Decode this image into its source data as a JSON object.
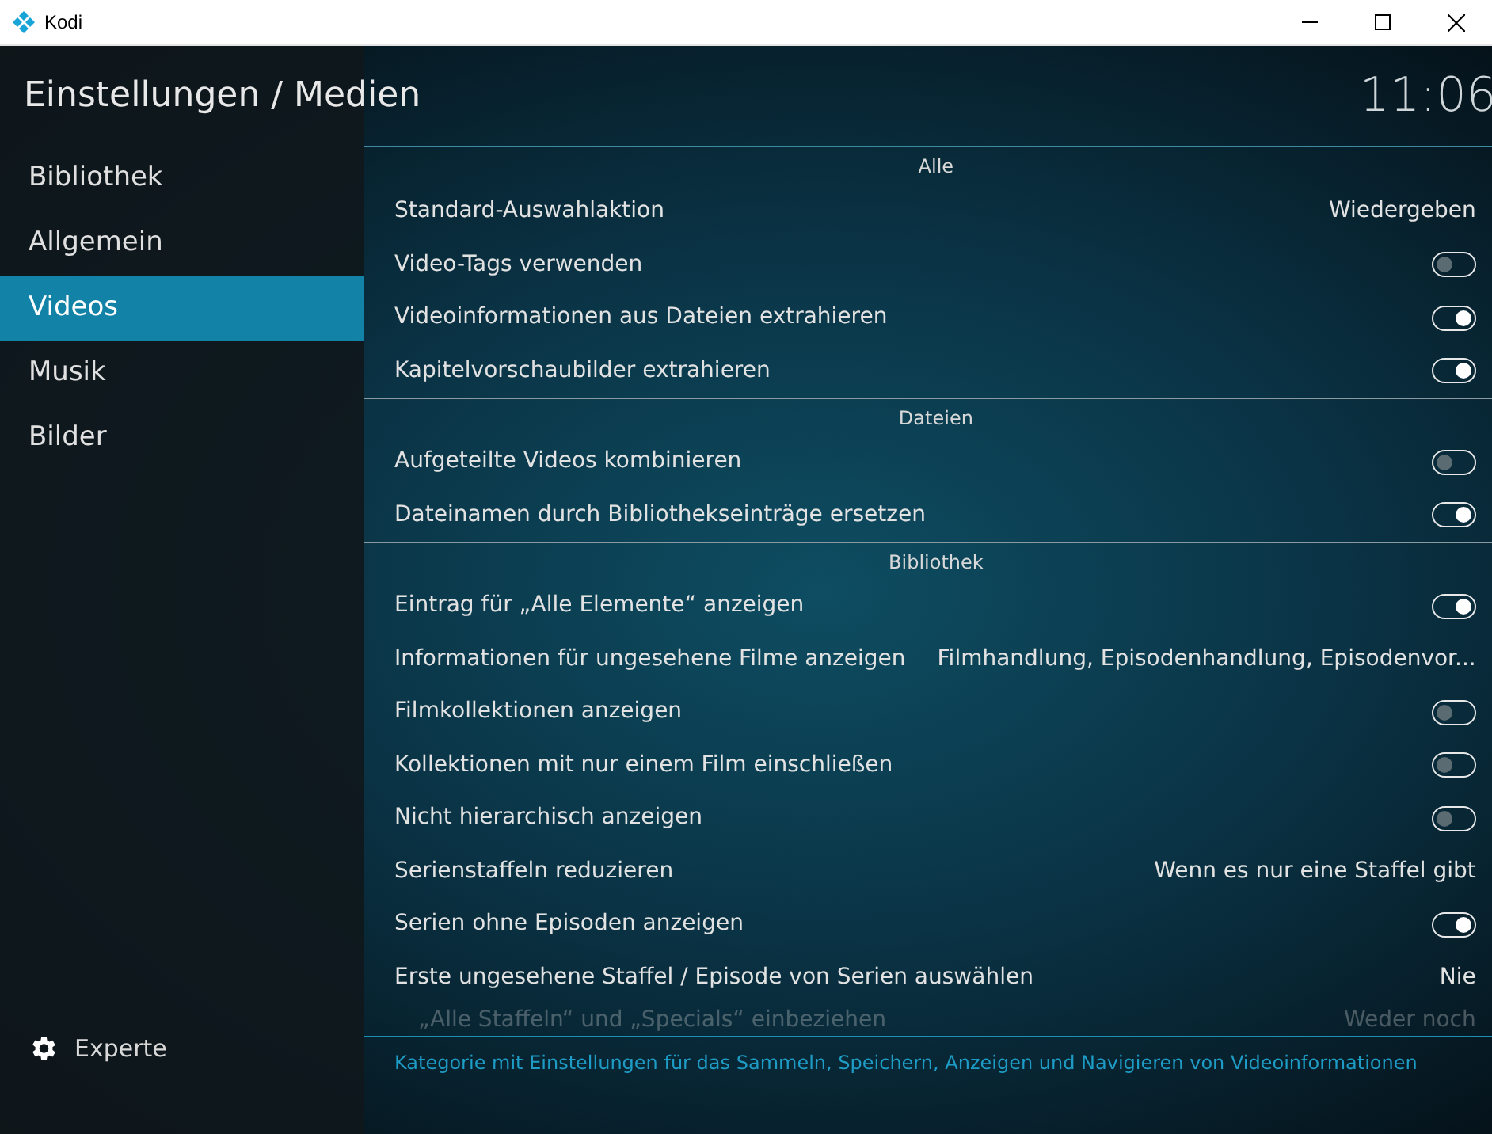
{
  "window": {
    "title": "Kodi"
  },
  "header": {
    "title": "Einstellungen / Medien",
    "clock": "11:06"
  },
  "sidebar": {
    "items": [
      {
        "label": "Bibliothek",
        "selected": false
      },
      {
        "label": "Allgemein",
        "selected": false
      },
      {
        "label": "Videos",
        "selected": true
      },
      {
        "label": "Musik",
        "selected": false
      },
      {
        "label": "Bilder",
        "selected": false
      }
    ],
    "level_button": "Experte"
  },
  "sections": [
    {
      "title": "Alle",
      "rows": [
        {
          "kind": "value",
          "label": "Standard-Auswahlaktion",
          "value": "Wiedergeben",
          "disabled": false
        },
        {
          "kind": "toggle",
          "label": "Video-Tags verwenden",
          "on": false,
          "disabled": false
        },
        {
          "kind": "toggle",
          "label": "Videoinformationen aus Dateien extrahieren",
          "on": true,
          "disabled": false
        },
        {
          "kind": "toggle",
          "label": "Kapitelvorschaubilder extrahieren",
          "on": true,
          "disabled": false
        }
      ]
    },
    {
      "title": "Dateien",
      "rows": [
        {
          "kind": "toggle",
          "label": "Aufgeteilte Videos kombinieren",
          "on": false,
          "disabled": false
        },
        {
          "kind": "toggle",
          "label": "Dateinamen durch Bibliothekseinträge ersetzen",
          "on": true,
          "disabled": false
        }
      ]
    },
    {
      "title": "Bibliothek",
      "rows": [
        {
          "kind": "toggle",
          "label": "Eintrag für „Alle Elemente“ anzeigen",
          "on": true,
          "disabled": false
        },
        {
          "kind": "value",
          "label": "Informationen für ungesehene Filme anzeigen",
          "value": "Filmhandlung, Episodenhandlung, Episodenvor...",
          "disabled": false
        },
        {
          "kind": "toggle",
          "label": "Filmkollektionen anzeigen",
          "on": false,
          "disabled": false
        },
        {
          "kind": "toggle",
          "label": "Kollektionen mit nur einem Film einschließen",
          "on": false,
          "disabled": false
        },
        {
          "kind": "toggle",
          "label": "Nicht hierarchisch anzeigen",
          "on": false,
          "disabled": false
        },
        {
          "kind": "value",
          "label": "Serienstaffeln reduzieren",
          "value": "Wenn es nur eine Staffel gibt",
          "disabled": false
        },
        {
          "kind": "toggle",
          "label": "Serien ohne Episoden anzeigen",
          "on": true,
          "disabled": false
        },
        {
          "kind": "value",
          "label": "Erste ungesehene Staffel / Episode von Serien auswählen",
          "value": "Nie",
          "disabled": false
        },
        {
          "kind": "value",
          "label": "„Alle Staffeln“ und „Specials“ einbeziehen",
          "value": "Weder noch",
          "disabled": true
        }
      ]
    }
  ],
  "description": "Kategorie mit Einstellungen für das Sammeln, Speichern, Anzeigen und Navigieren von Videoinformationen"
}
